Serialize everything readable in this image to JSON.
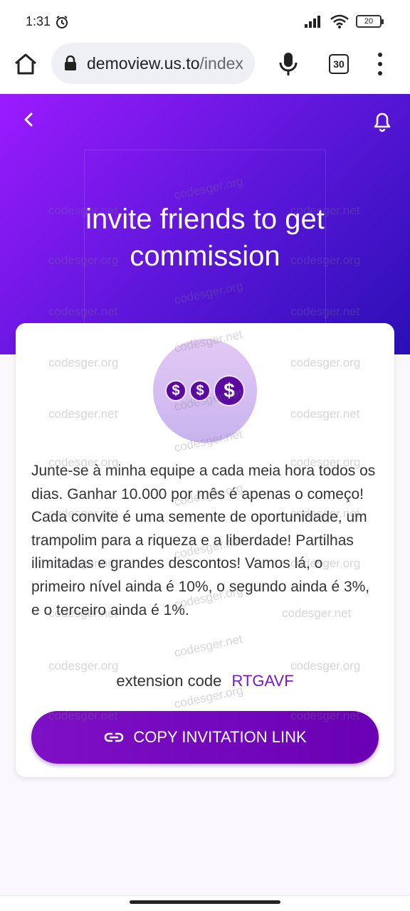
{
  "status_bar": {
    "time": "1:31",
    "battery": "20"
  },
  "browser": {
    "url_host": "demoview.us.to",
    "url_path": "/index",
    "tab_count": "30"
  },
  "hero": {
    "title": "invite friends to get commission"
  },
  "card": {
    "description": "Junte-se à minha equipe a cada meia hora todos os dias. Ganhar 10.000 por mês é apenas o começo! Cada convite é uma semente de oportunidade, um trampolim para a riqueza e a liberdade! Partilhas ilimitadas e grandes descontos! Vamos lá, o primeiro nível ainda é 10%, o segundo ainda é 3%, e o terceiro ainda é 1%.",
    "extension_label": "extension code",
    "extension_code": "RTGAVF",
    "copy_button_label": "COPY INVITATION LINK"
  },
  "watermarks": {
    "net": "codesger.net",
    "org": "codesger.org"
  },
  "colors": {
    "accent": "#7a18c2",
    "hero_start": "#9b1bff",
    "hero_end": "#2a0fb5"
  }
}
